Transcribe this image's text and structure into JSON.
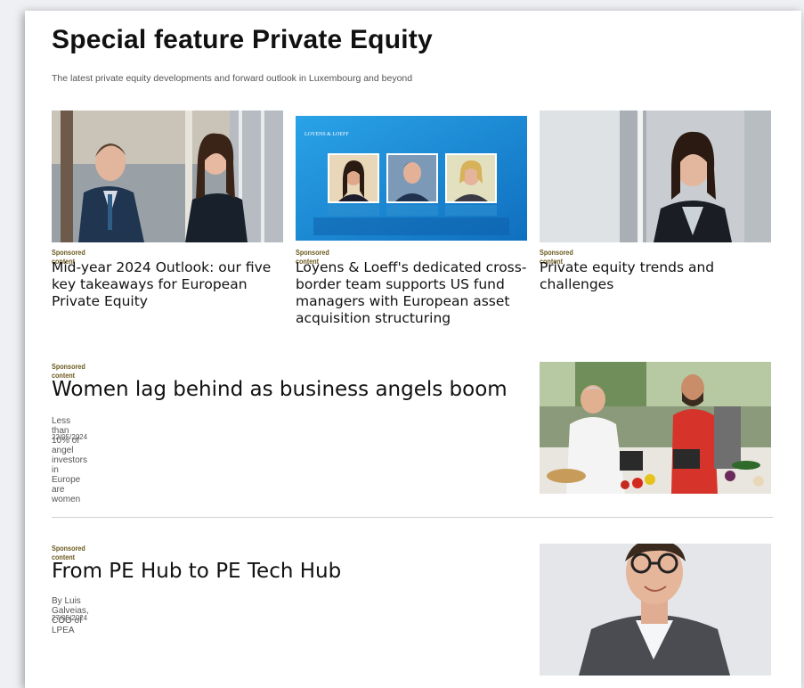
{
  "header": {
    "title": "Special feature Private Equity",
    "subtitle": "The latest private equity developments and forward outlook in Luxembourg and beyond"
  },
  "cards": [
    {
      "label": "Sponsored content",
      "title": "Mid-year 2024 Outlook: our five key takeaways for European Private Equity",
      "image": "two-professionals-office-photo"
    },
    {
      "label": "Sponsored content",
      "title": "Loyens & Loeff's dedicated cross-border team supports US fund managers with European asset acquisition structuring",
      "image": "loyens-loeff-team-banner",
      "image_brand": "LOYENS & LOEFF"
    },
    {
      "label": "Sponsored content",
      "title": "Private equity trends and challenges",
      "image": "businesswoman-portrait-photo"
    }
  ],
  "features": [
    {
      "label": "Sponsored content",
      "title": "Women lag behind as business angels boom",
      "subtitle": "Less than 10% of angel investors in Europe are women",
      "date": "22/05/2024",
      "image": "cooking-class-photo"
    },
    {
      "label": "Sponsored content",
      "title": "From PE Hub to PE Tech Hub",
      "subtitle": "By Luis Galveias, COO of LPEA",
      "date": "27/05/2024",
      "image": "man-with-glasses-portrait-photo"
    }
  ],
  "colors": {
    "sponsored_label": "#6b5a1e",
    "banner_blue": "#1e8fd8",
    "divider": "#cfcfcf"
  }
}
